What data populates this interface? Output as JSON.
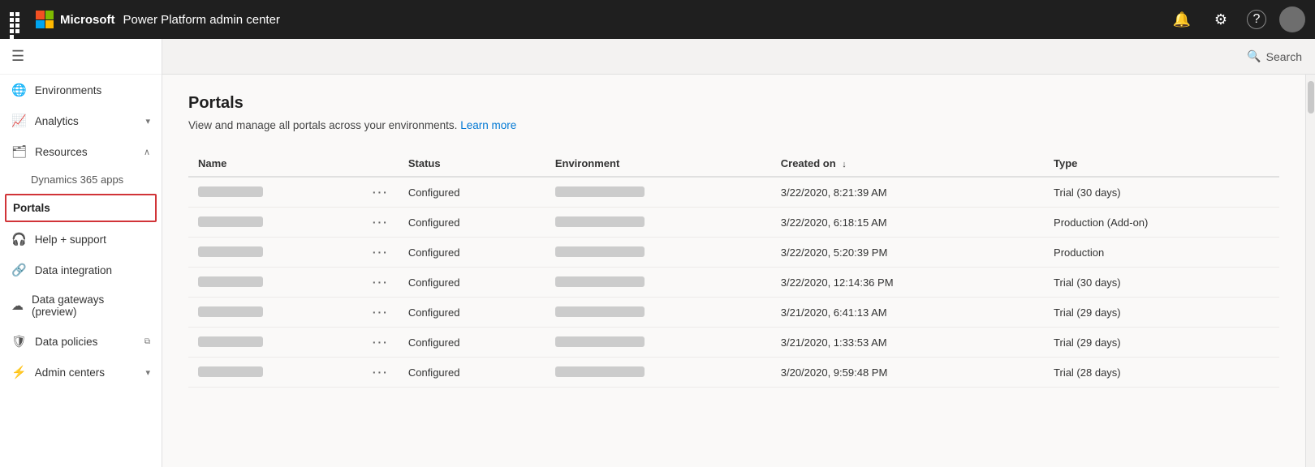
{
  "topbar": {
    "app_name": "Power Platform admin center",
    "search_label": "Search"
  },
  "sidebar": {
    "hamburger_label": "☰",
    "items": [
      {
        "id": "environments",
        "label": "Environments",
        "icon": "🌐",
        "chevron": ""
      },
      {
        "id": "analytics",
        "label": "Analytics",
        "icon": "📈",
        "chevron": "▾"
      },
      {
        "id": "resources",
        "label": "Resources",
        "icon": "🗂",
        "chevron": "∧"
      },
      {
        "id": "dynamics365",
        "label": "Dynamics 365 apps",
        "icon": "",
        "sub": true
      },
      {
        "id": "portals",
        "label": "Portals",
        "icon": "",
        "sub": true,
        "active": true
      },
      {
        "id": "help-support",
        "label": "Help + support",
        "icon": "🎧",
        "chevron": ""
      },
      {
        "id": "data-integration",
        "label": "Data integration",
        "icon": "🔗",
        "chevron": ""
      },
      {
        "id": "data-gateways",
        "label": "Data gateways (preview)",
        "icon": "☁",
        "chevron": ""
      },
      {
        "id": "data-policies",
        "label": "Data policies",
        "icon": "🛡",
        "chevron": "⧉"
      },
      {
        "id": "admin-centers",
        "label": "Admin centers",
        "icon": "⚡",
        "chevron": "▾"
      }
    ]
  },
  "content": {
    "page_title": "Portals",
    "subtitle": "View and manage all portals across your environments.",
    "learn_more": "Learn more",
    "table": {
      "columns": [
        {
          "id": "name",
          "label": "Name"
        },
        {
          "id": "status",
          "label": "Status"
        },
        {
          "id": "environment",
          "label": "Environment"
        },
        {
          "id": "created_on",
          "label": "Created on",
          "sort": "↓"
        },
        {
          "id": "type",
          "label": "Type"
        }
      ],
      "rows": [
        {
          "name_blur": "████████",
          "status": "Configured",
          "env_blur": "████████████",
          "created_on": "3/22/2020, 8:21:39 AM",
          "type": "Trial (30 days)"
        },
        {
          "name_blur": "████████",
          "status": "Configured",
          "env_blur": "████████████",
          "created_on": "3/22/2020, 6:18:15 AM",
          "type": "Production (Add-on)"
        },
        {
          "name_blur": "████████",
          "status": "Configured",
          "env_blur": "████████████",
          "created_on": "3/22/2020, 5:20:39 PM",
          "type": "Production"
        },
        {
          "name_blur": "████████",
          "status": "Configured",
          "env_blur": "████████████",
          "created_on": "3/22/2020, 12:14:36 PM",
          "type": "Trial (30 days)"
        },
        {
          "name_blur": "████████",
          "status": "Configured",
          "env_blur": "████████████",
          "created_on": "3/21/2020, 6:41:13 AM",
          "type": "Trial (29 days)"
        },
        {
          "name_blur": "████████",
          "status": "Configured",
          "env_blur": "████████████",
          "created_on": "3/21/2020, 1:33:53 AM",
          "type": "Trial (29 days)"
        },
        {
          "name_blur": "████████",
          "status": "Configured",
          "env_blur": "████████████",
          "created_on": "3/20/2020, 9:59:48 PM",
          "type": "Trial (28 days)"
        }
      ]
    }
  }
}
